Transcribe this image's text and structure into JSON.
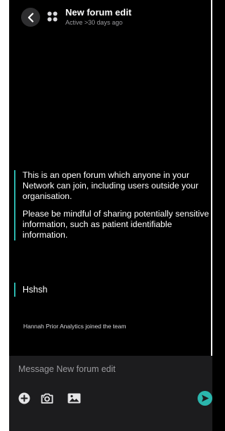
{
  "colors": {
    "accent": "#2bb6ad",
    "background": "#000000",
    "composer_bg": "#1c1c1e",
    "muted_text": "#9a9a9e"
  },
  "header": {
    "back_icon": "chevron-left-icon",
    "group_icon": "group-dots-icon",
    "title": "New forum edit",
    "subtitle": "Active >30 days ago"
  },
  "messages": {
    "notice": {
      "paragraph_1": "This is an open forum which anyone in your Network can join, including users outside your organisation.",
      "paragraph_2": "Please be mindful of sharing potentially sensitive information, such as patient identifiable information."
    },
    "user_message": "Hshsh",
    "system_event": "Hannah Prior Analytics joined the team"
  },
  "composer": {
    "placeholder": "Message New forum edit",
    "tools": [
      "plus-icon",
      "camera-icon",
      "image-icon"
    ],
    "send_icon": "send-icon"
  }
}
